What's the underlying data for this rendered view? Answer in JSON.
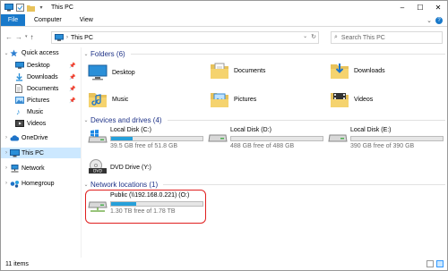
{
  "window": {
    "title": "This PC",
    "controls": [
      "–",
      "☐",
      "✕"
    ]
  },
  "ribbon": {
    "tabs": [
      {
        "label": "File",
        "active": true
      },
      {
        "label": "Computer"
      },
      {
        "label": "View"
      }
    ],
    "expand_icon": "chevron-down",
    "help_icon": "?"
  },
  "navbar": {
    "breadcrumb": "This PC",
    "search_placeholder": "Search This PC",
    "search_icon": "magnifier"
  },
  "sidebar": {
    "items": [
      {
        "label": "Quick access",
        "icon": "star-icon",
        "level": 0,
        "expanded": true,
        "pinned": false
      },
      {
        "label": "Desktop",
        "icon": "desktop-icon",
        "level": 1,
        "pinned": true
      },
      {
        "label": "Downloads",
        "icon": "downloads-icon",
        "level": 1,
        "pinned": true
      },
      {
        "label": "Documents",
        "icon": "documents-icon",
        "level": 1,
        "pinned": true
      },
      {
        "label": "Pictures",
        "icon": "pictures-icon",
        "level": 1,
        "pinned": true
      },
      {
        "label": "Music",
        "icon": "music-icon",
        "level": 1,
        "pinned": false
      },
      {
        "label": "Videos",
        "icon": "videos-icon",
        "level": 1,
        "pinned": false
      },
      {
        "label": "OneDrive",
        "icon": "cloud-icon",
        "level": 0,
        "expanded": false
      },
      {
        "label": "This PC",
        "icon": "computer-icon",
        "level": 0,
        "expanded": false,
        "selected": true
      },
      {
        "label": "Network",
        "icon": "network-icon",
        "level": 0,
        "expanded": false
      },
      {
        "label": "Homegroup",
        "icon": "homegroup-icon",
        "level": 0,
        "expanded": false
      }
    ]
  },
  "main": {
    "folders_group": {
      "title": "Folders (6)",
      "items": [
        {
          "label": "Desktop",
          "icon": "desktop-folder-icon"
        },
        {
          "label": "Documents",
          "icon": "documents-folder-icon"
        },
        {
          "label": "Downloads",
          "icon": "downloads-folder-icon"
        },
        {
          "label": "Music",
          "icon": "music-folder-icon"
        },
        {
          "label": "Pictures",
          "icon": "pictures-folder-icon"
        },
        {
          "label": "Videos",
          "icon": "videos-folder-icon"
        }
      ]
    },
    "drives_group": {
      "title": "Devices and drives (4)",
      "items": [
        {
          "label": "Local Disk (C:)",
          "free_text": "39.5 GB free of 51.8 GB",
          "used_fraction": 0.24,
          "icon": "windows-disk-icon"
        },
        {
          "label": "Local Disk (D:)",
          "free_text": "488 GB free of 488 GB",
          "used_fraction": 0.0,
          "icon": "disk-icon"
        },
        {
          "label": "Local Disk (E:)",
          "free_text": "390 GB free of 390 GB",
          "used_fraction": 0.0,
          "icon": "disk-icon"
        },
        {
          "label": "DVD Drive (Y:)",
          "icon": "dvd-drive-icon"
        }
      ]
    },
    "network_group": {
      "title": "Network locations (1)",
      "items": [
        {
          "label": "Public (\\\\192.168.0.221) (O:)",
          "free_text": "1.30 TB free of 1.78 TB",
          "used_fraction": 0.27,
          "icon": "network-drive-icon",
          "highlighted": true
        }
      ]
    }
  },
  "status": {
    "item_count": "11 items"
  },
  "colors": {
    "accent": "#1979ca",
    "selection": "#cce8ff",
    "group_title": "#1e3287",
    "bar_fill": "#26a0da",
    "highlight_border": "#e02020"
  }
}
